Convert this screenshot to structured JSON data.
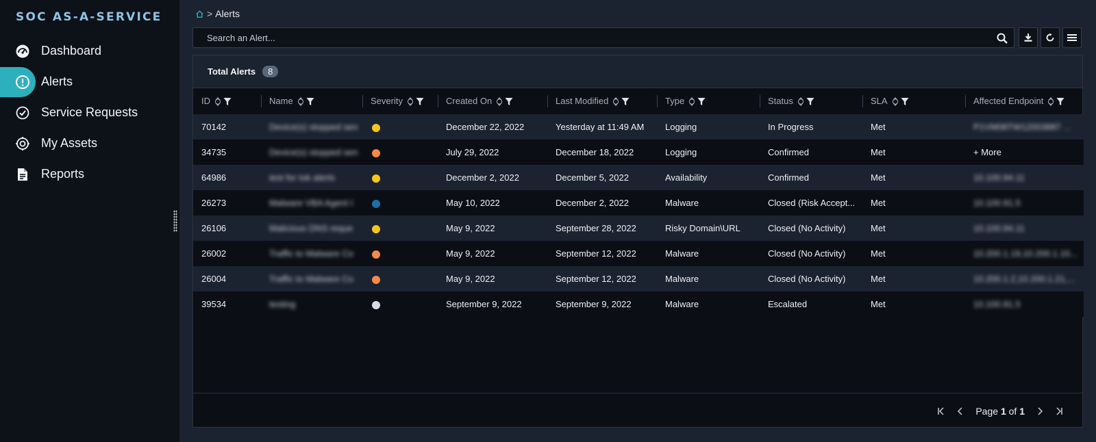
{
  "brand": "SOC AS-A-SERVICE",
  "sidebar": {
    "items": [
      {
        "label": "Dashboard",
        "icon": "speedometer-icon"
      },
      {
        "label": "Alerts",
        "icon": "alert-circle-icon",
        "active": true
      },
      {
        "label": "Service Requests",
        "icon": "check-circle-icon"
      },
      {
        "label": "My Assets",
        "icon": "target-icon"
      },
      {
        "label": "Reports",
        "icon": "document-icon"
      }
    ]
  },
  "breadcrumb": {
    "separator": ">",
    "current": "Alerts"
  },
  "search": {
    "placeholder": "Search an Alert..."
  },
  "panel": {
    "title": "Total Alerts",
    "count": "8"
  },
  "table": {
    "columns": [
      "ID",
      "Name",
      "Severity",
      "Created On",
      "Last Modified",
      "Type",
      "Status",
      "SLA",
      "Affected Endpoint"
    ],
    "rows": [
      {
        "id": "70142",
        "name": "Device(s) stopped sen",
        "severity_color": "#f5c518",
        "created": "December 22, 2022",
        "modified": "Yesterday at 11:49 AM",
        "type": "Logging",
        "status": "In Progress",
        "sla": "Met",
        "endpoint": "P1VM08TW12003887 ..."
      },
      {
        "id": "34735",
        "name": "Device(s) stopped sen",
        "severity_color": "#f5894a",
        "created": "July 29, 2022",
        "modified": "December 18, 2022",
        "type": "Logging",
        "status": "Confirmed",
        "sla": "Met",
        "endpoint": "+ More"
      },
      {
        "id": "64986",
        "name": "test for tok alerts",
        "severity_color": "#f5c518",
        "created": "December 2, 2022",
        "modified": "December 5, 2022",
        "type": "Availability",
        "status": "Confirmed",
        "sla": "Met",
        "endpoint": "10.100.94.11"
      },
      {
        "id": "26273",
        "name": "Malware VBA Agent I",
        "severity_color": "#1d6fa8",
        "created": "May 10, 2022",
        "modified": "December 2, 2022",
        "type": "Malware",
        "status": "Closed (Risk Accept...",
        "sla": "Met",
        "endpoint": "10.100.91.5"
      },
      {
        "id": "26106",
        "name": "Malicious DNS reque",
        "severity_color": "#f5c518",
        "created": "May 9, 2022",
        "modified": "September 28, 2022",
        "type": "Risky Domain\\URL",
        "status": "Closed (No Activity)",
        "sla": "Met",
        "endpoint": "10.100.94.11"
      },
      {
        "id": "26002",
        "name": "Traffic to Malware Co",
        "severity_color": "#f5894a",
        "created": "May 9, 2022",
        "modified": "September 12, 2022",
        "type": "Malware",
        "status": "Closed (No Activity)",
        "sla": "Met",
        "endpoint": "10.200.1.19,10.200.1.10..."
      },
      {
        "id": "26004",
        "name": "Traffic to Malware Co",
        "severity_color": "#f5894a",
        "created": "May 9, 2022",
        "modified": "September 12, 2022",
        "type": "Malware",
        "status": "Closed (No Activity)",
        "sla": "Met",
        "endpoint": "10.200.1.2,10.200.1.21,..."
      },
      {
        "id": "39534",
        "name": "testing",
        "severity_color": "#d6dbe6",
        "created": "September 9, 2022",
        "modified": "September 9, 2022",
        "type": "Malware",
        "status": "Escalated",
        "sla": "Met",
        "endpoint": "10.100.91.5"
      }
    ]
  },
  "pagination": {
    "prefix": "Page",
    "current": "1",
    "of": "of",
    "total": "1"
  }
}
